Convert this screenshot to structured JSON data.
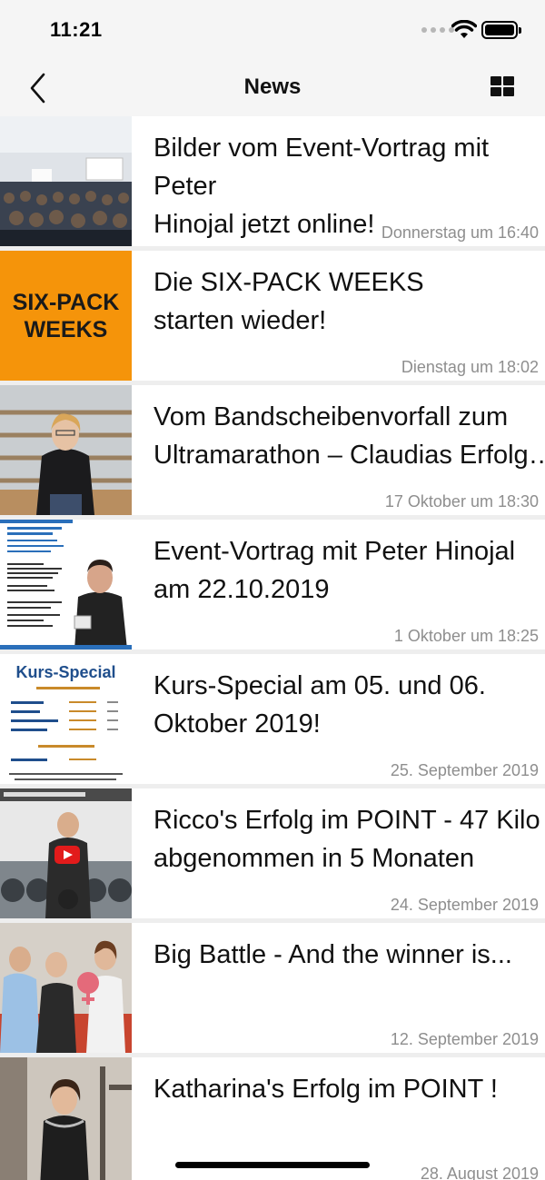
{
  "status_bar": {
    "time": "11:21"
  },
  "nav": {
    "title": "News"
  },
  "thumb_text": {
    "sixpack": "SIX-PACK\nWEEKS",
    "kurs_title": "Kurs-Special"
  },
  "news": [
    {
      "title": "Bilder vom Event-Vortrag mit Peter\nHinojal jetzt online!",
      "date": "Donnerstag um 16:40",
      "thumb": "event-audience"
    },
    {
      "title": "Die SIX-PACK WEEKS\nstarten wieder!",
      "date": "Dienstag um 18:02",
      "thumb": "six-pack-weeks"
    },
    {
      "title": "Vom Bandscheibenvorfall zum\nUltramarathon – Claudias Erfolg…",
      "date": "17 Oktober um 18:30",
      "thumb": "claudia-portrait"
    },
    {
      "title": "Event-Vortrag mit Peter Hinojal\nam 22.10.2019",
      "date": "1 Oktober um 18:25",
      "thumb": "event-flyer"
    },
    {
      "title": "Kurs-Special am 05. und 06.\nOktober 2019!",
      "date": "25. September 2019",
      "thumb": "kurs-special"
    },
    {
      "title": "Ricco's Erfolg im POINT - 47 Kilo\nabgenommen in 5 Monaten",
      "date": "24. September 2019",
      "thumb": "ricco-video"
    },
    {
      "title": "Big Battle - And the winner is...",
      "date": "12. September 2019",
      "thumb": "big-battle"
    },
    {
      "title": "Katharina's Erfolg im POINT !",
      "date": "28. August 2019",
      "thumb": "katharina-gym"
    }
  ],
  "colors": {
    "accent_orange": "#f5940a",
    "date_gray": "#8e8e8e",
    "kurs_blue": "#1f4e8c"
  },
  "icons": {
    "back": "chevron-left-icon",
    "layout": "grid-view-icon",
    "wifi": "wifi-icon",
    "battery": "battery-icon"
  }
}
